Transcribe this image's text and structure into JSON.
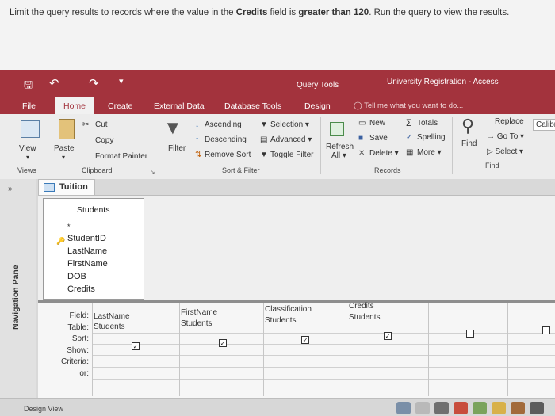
{
  "instruction": {
    "part1": "Limit the query results to records where the value in the ",
    "bold1": "Credits",
    "part2": " field is ",
    "bold2": "greater than 120",
    "part3": ". Run the query to view the results."
  },
  "title_bar": {
    "context_tab": "Query Tools",
    "app_title": "University Registration - Access"
  },
  "tabs": [
    "File",
    "Home",
    "Create",
    "External Data",
    "Database Tools",
    "Design"
  ],
  "active_tab": "Home",
  "tell_me": "Tell me what you want to do...",
  "ribbon": {
    "views": {
      "view": "View",
      "group": "Views"
    },
    "clipboard": {
      "paste": "Paste",
      "cut": "Cut",
      "copy": "Copy",
      "format_painter": "Format Painter",
      "group": "Clipboard"
    },
    "sort_filter": {
      "filter": "Filter",
      "ascending": "Ascending",
      "descending": "Descending",
      "remove_sort": "Remove Sort",
      "selection": "Selection",
      "advanced": "Advanced",
      "toggle_filter": "Toggle Filter",
      "group": "Sort & Filter"
    },
    "records": {
      "refresh": "Refresh",
      "all": "All",
      "new": "New",
      "save": "Save",
      "delete": "Delete",
      "totals": "Totals",
      "spelling": "Spelling",
      "more": "More",
      "group": "Records"
    },
    "find": {
      "find": "Find",
      "replace": "Replace",
      "go_to": "Go To",
      "select": "Select",
      "group": "Find"
    },
    "font": {
      "font_name": "Calibr"
    }
  },
  "nav_pane": {
    "label": "Navigation Pane",
    "toggle": "»"
  },
  "document_tab": "Tuition",
  "field_list": {
    "table": "Students",
    "star": "*",
    "fields": [
      "StudentID",
      "LastName",
      "FirstName",
      "DOB",
      "Credits"
    ]
  },
  "design_grid": {
    "row_labels": [
      "Field:",
      "Table:",
      "Sort:",
      "Show:",
      "Criteria:",
      "or:"
    ],
    "columns": [
      {
        "field": "LastName",
        "table": "Students",
        "show": true
      },
      {
        "field": "FirstName",
        "table": "Students",
        "show": true
      },
      {
        "field": "Classification",
        "table": "Students",
        "show": true
      },
      {
        "field": "Credits",
        "table": "Students",
        "show": true
      },
      {
        "field": "",
        "table": "",
        "show": false
      },
      {
        "field": "",
        "table": "",
        "show": false
      }
    ]
  },
  "status_bar": {
    "view": "Design View"
  },
  "colors": {
    "accent": "#a3333d"
  }
}
